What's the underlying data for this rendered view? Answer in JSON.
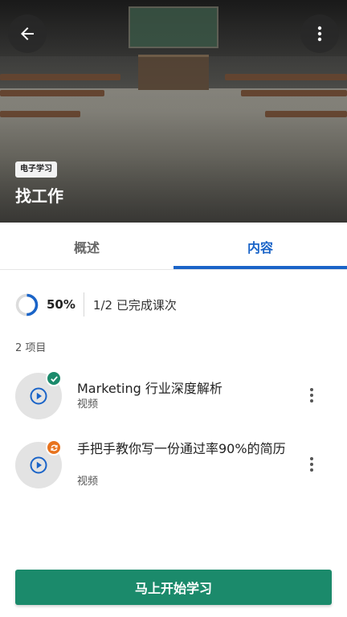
{
  "header": {
    "tag": "电子学习",
    "title": "找工作",
    "back_icon": "arrow-left-icon",
    "more_icon": "more-vertical-icon"
  },
  "tabs": [
    {
      "label": "概述",
      "active": false
    },
    {
      "label": "内容",
      "active": true
    }
  ],
  "progress": {
    "percent": 50,
    "percent_label": "50%",
    "summary": "1/2 已完成课次"
  },
  "items_count_label": "2 项目",
  "items": [
    {
      "title": "Marketing 行业深度解析",
      "type": "视频",
      "status": "completed",
      "status_icon": "check-icon",
      "thumb_icon": "play-circle-icon"
    },
    {
      "title": "手把手教你写一份通过率90%的简历",
      "type": "视频",
      "status": "in-progress",
      "status_icon": "sync-icon",
      "thumb_icon": "play-circle-icon"
    }
  ],
  "cta": {
    "label": "马上开始学习"
  },
  "colors": {
    "accent_blue": "#1a64c8",
    "cta_green": "#1b8a6b",
    "status_done": "#1b8a6b",
    "status_progress": "#e8731e"
  }
}
